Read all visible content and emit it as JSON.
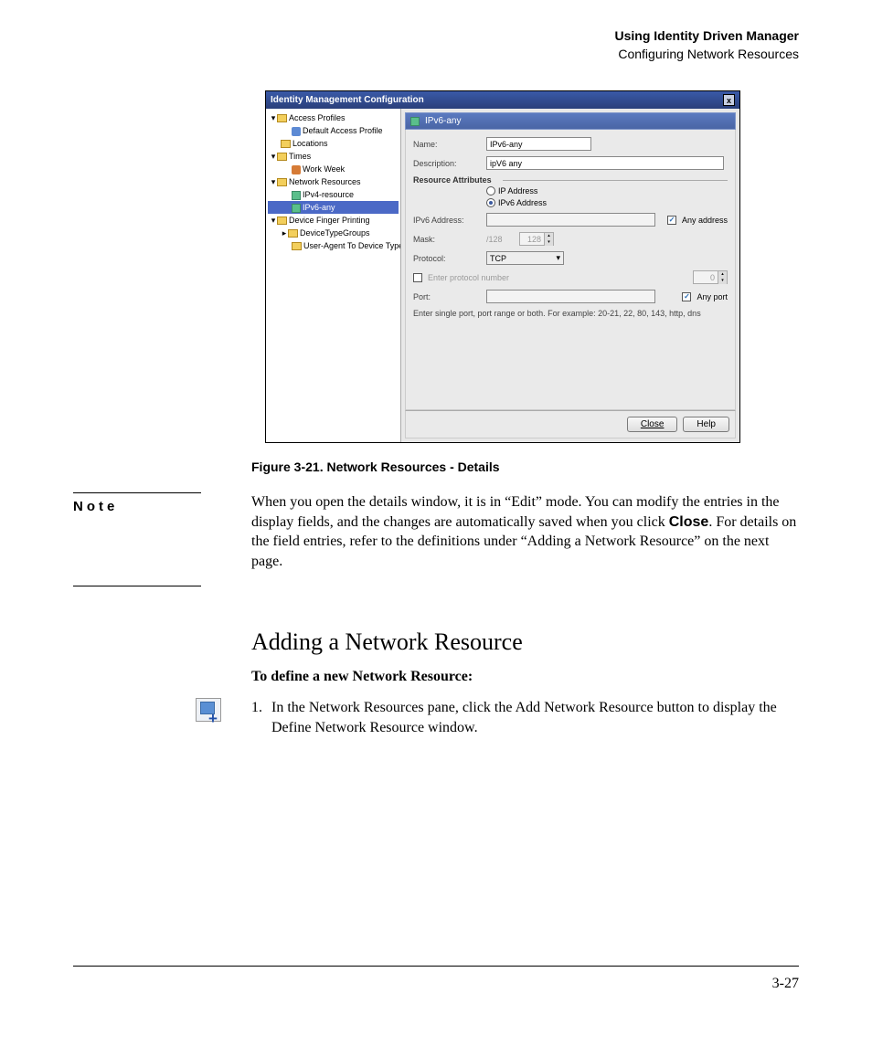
{
  "header": {
    "title": "Using Identity Driven Manager",
    "subtitle": "Configuring Network Resources"
  },
  "screenshot": {
    "window_title": "Identity Management Configuration",
    "tree": {
      "access_profiles": "Access Profiles",
      "default_access_profile": "Default Access Profile",
      "locations": "Locations",
      "times": "Times",
      "work_week": "Work Week",
      "network_resources": "Network Resources",
      "ipv4_resource": "IPv4-resource",
      "ipv6_any": "IPv6-any",
      "device_finger_printing": "Device Finger Printing",
      "device_type_groups": "DeviceTypeGroups",
      "user_agent_to_device_types": "User-Agent To Device Types"
    },
    "pane_title": "IPv6-any",
    "fields": {
      "name_label": "Name:",
      "name_value": "IPv6-any",
      "description_label": "Description:",
      "description_value": "ipV6 any",
      "resource_attributes_label": "Resource Attributes",
      "ip_address_radio": "IP Address",
      "ipv6_address_radio": "IPv6 Address",
      "ipv6_address_label": "IPv6 Address:",
      "any_address_label": "Any address",
      "mask_label": "Mask:",
      "mask_placeholder": "/128",
      "mask_spinner_value": "128",
      "protocol_label": "Protocol:",
      "protocol_value": "TCP",
      "enter_protocol_number_label": "Enter protocol number",
      "protocol_number_value": "0",
      "port_label": "Port:",
      "any_port_label": "Any port",
      "port_hint": "Enter single port, port range or both. For example: 20-21, 22, 80, 143, http, dns"
    },
    "buttons": {
      "close": "Close",
      "help": "Help"
    }
  },
  "figure_caption": "Figure 3-21. Network Resources - Details",
  "note": {
    "label": "Note",
    "text_before": "When you open the details window, it is in “Edit” mode. You can modify the entries in the display fields, and the changes are automatically saved when you click ",
    "close_word": "Close",
    "text_after": ". For details on the field entries, refer to the definitions under “Adding a Network Resource” on the next page."
  },
  "section_title": "Adding a Network Resource",
  "subhead": "To define a new Network Resource:",
  "step1": {
    "number": "1.",
    "text": "In the Network Resources pane, click the Add Network Resource button to display the Define Network Resource window."
  },
  "page_number": "3-27"
}
